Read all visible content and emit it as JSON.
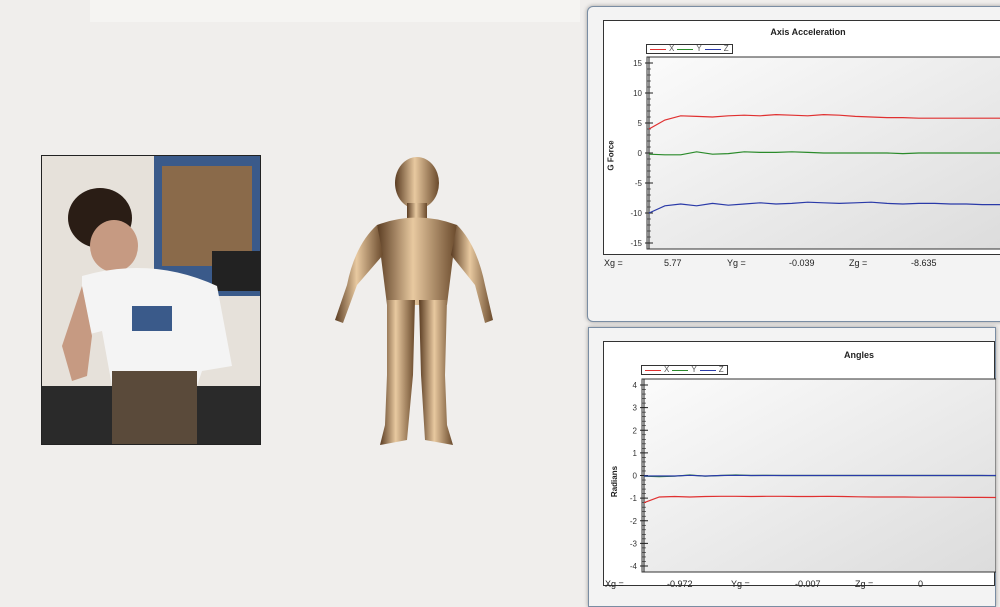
{
  "colors": {
    "x": "#e03030",
    "y": "#2a8a2a",
    "z": "#2a3aa8",
    "background": "#f0eeec"
  },
  "windows": [
    {
      "title": "Axis Acceleration",
      "ylabel": "G Force",
      "legend": [
        "X",
        "Y",
        "Z"
      ],
      "readout": {
        "x_label": "Xg =",
        "x_value": "5.77",
        "y_label": "Yg =",
        "y_value": "-0.039",
        "z_label": "Zg =",
        "z_value": "-8.635"
      }
    },
    {
      "title": "Angles",
      "ylabel": "Radians",
      "legend": [
        "X",
        "Y",
        "Z"
      ],
      "readout": {
        "x_label": "Xg =",
        "x_value": "-0.972",
        "y_label": "Yg =",
        "y_value": "-0.007",
        "z_label": "Zg =",
        "z_value": "0"
      }
    }
  ],
  "chart_data": [
    {
      "type": "line",
      "title": "Axis Acceleration",
      "xlabel": "",
      "ylabel": "G Force",
      "ylim": [
        -15,
        15
      ],
      "yticks": [
        15,
        10,
        5,
        0,
        -5,
        -10,
        -15
      ],
      "x": [
        0,
        1,
        2,
        3,
        4,
        5,
        6,
        7,
        8,
        9,
        10,
        11,
        12,
        13,
        14,
        15,
        16,
        17,
        18,
        19,
        20,
        21,
        22,
        23
      ],
      "series": [
        {
          "name": "X",
          "values": [
            4.0,
            5.5,
            6.2,
            6.1,
            6.0,
            6.2,
            6.3,
            6.2,
            6.4,
            6.3,
            6.2,
            6.4,
            6.3,
            6.1,
            6.0,
            5.9,
            5.9,
            5.8,
            5.8,
            5.8,
            5.8,
            5.8,
            5.8,
            5.77
          ]
        },
        {
          "name": "Y",
          "values": [
            -0.2,
            -0.3,
            -0.3,
            0.2,
            -0.2,
            -0.1,
            0.2,
            0.1,
            0.1,
            0.2,
            0.1,
            0.0,
            0.0,
            0.0,
            0.0,
            0.0,
            -0.1,
            0.0,
            0.0,
            0.0,
            0.0,
            0.0,
            0.0,
            -0.039
          ]
        },
        {
          "name": "Z",
          "values": [
            -10.0,
            -8.8,
            -8.5,
            -8.8,
            -8.4,
            -8.7,
            -8.5,
            -8.3,
            -8.5,
            -8.4,
            -8.2,
            -8.3,
            -8.4,
            -8.3,
            -8.2,
            -8.4,
            -8.5,
            -8.4,
            -8.4,
            -8.5,
            -8.5,
            -8.6,
            -8.6,
            -8.635
          ]
        }
      ],
      "legend_position": "top-left",
      "grid": false
    },
    {
      "type": "line",
      "title": "Angles",
      "xlabel": "",
      "ylabel": "Radians",
      "ylim": [
        -4,
        4
      ],
      "yticks": [
        4,
        3,
        2,
        1,
        0,
        -1,
        -2,
        -3,
        -4
      ],
      "x": [
        0,
        1,
        2,
        3,
        4,
        5,
        6,
        7,
        8,
        9,
        10,
        11,
        12,
        13,
        14,
        15,
        16,
        17,
        18,
        19,
        20,
        21,
        22,
        23
      ],
      "series": [
        {
          "name": "X",
          "values": [
            -1.2,
            -0.95,
            -0.93,
            -0.95,
            -0.93,
            -0.92,
            -0.92,
            -0.93,
            -0.92,
            -0.92,
            -0.93,
            -0.93,
            -0.92,
            -0.93,
            -0.94,
            -0.95,
            -0.95,
            -0.95,
            -0.96,
            -0.96,
            -0.96,
            -0.97,
            -0.97,
            -0.972
          ]
        },
        {
          "name": "Y",
          "values": [
            -0.03,
            -0.05,
            -0.03,
            0.02,
            -0.03,
            0.0,
            0.02,
            0.0,
            0.01,
            0.0,
            0.0,
            0.0,
            0.0,
            0.0,
            0.0,
            0.0,
            0.0,
            0.0,
            0.0,
            0.0,
            0.0,
            0.0,
            0.0,
            -0.007
          ]
        },
        {
          "name": "Z",
          "values": [
            -0.02,
            -0.02,
            -0.02,
            0.01,
            -0.02,
            0.0,
            0.01,
            0.0,
            0.0,
            0.0,
            0.0,
            0.0,
            0.0,
            0.0,
            0.0,
            0.0,
            0.0,
            0.0,
            0.0,
            0.0,
            0.0,
            0.0,
            0.0,
            0
          ]
        }
      ],
      "legend_position": "top-left",
      "grid": false
    }
  ]
}
